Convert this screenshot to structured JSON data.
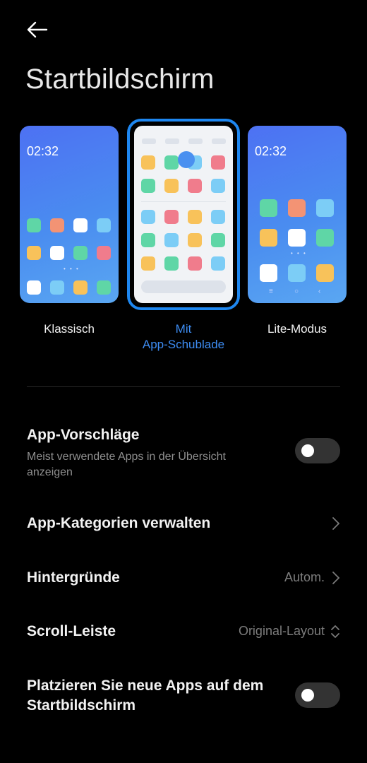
{
  "header": {
    "title": "Startbildschirm"
  },
  "layouts": [
    {
      "label": "Klassisch",
      "time": "02:32",
      "selected": false
    },
    {
      "label_line1": "Mit",
      "label_line2": "App-Schublade",
      "selected": true
    },
    {
      "label": "Lite-Modus",
      "time": "02:32",
      "selected": false
    }
  ],
  "settings": {
    "app_suggestions": {
      "title": "App-Vorschläge",
      "subtitle": "Meist verwendete Apps in der Übersicht anzeigen",
      "enabled": false
    },
    "app_categories": {
      "title": "App-Kategorien verwalten"
    },
    "wallpapers": {
      "title": "Hintergründe",
      "value": "Autom."
    },
    "scroll_bar": {
      "title": "Scroll-Leiste",
      "value": "Original-Layout"
    },
    "place_new_apps": {
      "title": "Platzieren Sie neue Apps auf dem Startbildschirm",
      "enabled": false
    }
  },
  "colors": {
    "accent": "#1e87f0",
    "background": "#000000"
  }
}
